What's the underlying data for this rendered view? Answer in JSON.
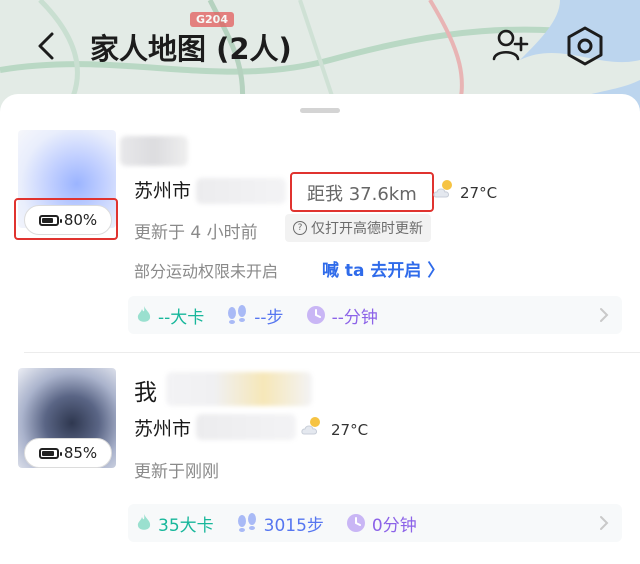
{
  "header": {
    "title": "家人地图 (2人)"
  },
  "map": {
    "road_badge": "G204"
  },
  "members": [
    {
      "battery": "80%",
      "battery_level": 0.8,
      "city": "苏州市",
      "distance": "距我 37.6km",
      "temperature": "27°C",
      "updated": "更新于 4 小时前",
      "hint": "仅打开高德时更新",
      "permission_text": "部分运动权限未开启",
      "permission_link": "喊 ta 去开启 〉",
      "stats": {
        "calories": "--大卡",
        "steps": "--步",
        "minutes": "--分钟"
      }
    },
    {
      "name": "我",
      "battery": "85%",
      "battery_level": 0.85,
      "city": "苏州市",
      "temperature": "27°C",
      "updated": "更新于刚刚",
      "stats": {
        "calories": "35大卡",
        "steps": "3015步",
        "minutes": "0分钟"
      }
    }
  ],
  "colors": {
    "highlight": "#e0332f",
    "link": "#2f6bea",
    "calories": "#18b79b",
    "steps": "#5676f0",
    "minutes": "#8c63e8"
  },
  "icons": [
    "back-icon",
    "add-user-icon",
    "settings-icon",
    "battery-icon",
    "weather-icon",
    "info-icon",
    "flame-icon",
    "footprints-icon",
    "clock-icon",
    "chevron-right-icon"
  ]
}
